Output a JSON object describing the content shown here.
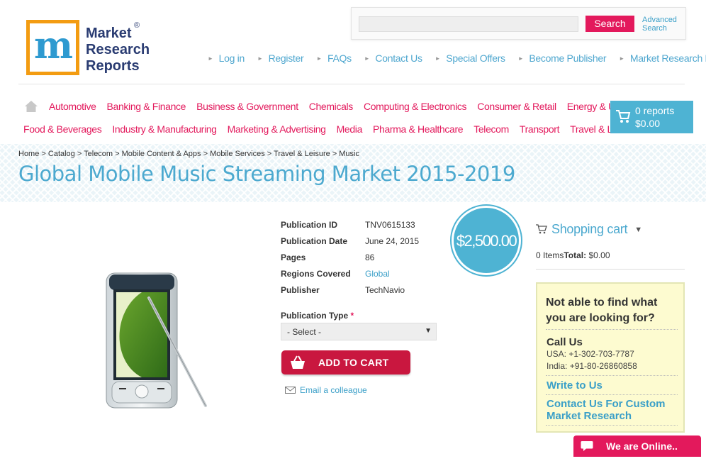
{
  "logo": {
    "text_line1": "Market",
    "text_line2": "Research",
    "text_line3": "Reports",
    "reg": "®",
    "mark": "m"
  },
  "search": {
    "button": "Search",
    "advanced": "Advanced Search",
    "value": ""
  },
  "top_links": [
    "Log in",
    "Register",
    "FAQs",
    "Contact Us",
    "Special Offers",
    "Become Publisher",
    "Market Research Blog"
  ],
  "nav_row1": [
    "Automotive",
    "Banking & Finance",
    "Business & Government",
    "Chemicals",
    "Computing & Electronics",
    "Consumer & Retail",
    "Energy & Utilities"
  ],
  "nav_row2": [
    "Food & Beverages",
    "Industry & Manufacturing",
    "Marketing & Advertising",
    "Media",
    "Pharma & Healthcare",
    "Telecom",
    "Transport",
    "Travel & Leisure"
  ],
  "cart_button": {
    "count": "0 reports",
    "total": "$0.00"
  },
  "breadcrumb": "Home > Catalog > Telecom > Mobile Content & Apps > Mobile Services > Travel & Leisure > Music",
  "page_title": "Global Mobile Music Streaming Market 2015-2019",
  "details": [
    {
      "label": "Publication ID",
      "value": "TNV0615133"
    },
    {
      "label": "Publication Date",
      "value": "June 24, 2015"
    },
    {
      "label": "Pages",
      "value": "86"
    },
    {
      "label": "Regions Covered",
      "value": "Global"
    },
    {
      "label": "Publisher",
      "value": "TechNavio"
    }
  ],
  "price": "$2,500.00",
  "publication_type": {
    "label": "Publication Type",
    "required_mark": "*",
    "selected": "- Select -"
  },
  "add_to_cart": "ADD TO CART",
  "email_colleague": "Email a colleague",
  "shopping_cart": {
    "title": "Shopping cart",
    "items": "0 Items",
    "total_label": "Total:",
    "total": "$0.00"
  },
  "help_box": {
    "question": "Not able to find what you are looking for?",
    "call_us": "Call Us",
    "usa": "USA: +1-302-703-7787",
    "india": "India: +91-80-26860858",
    "write": "Write to Us",
    "custom": "Contact Us For Custom Market Research"
  },
  "online_chat": "We are Online..",
  "colors": {
    "accent_pink": "#e3195c",
    "accent_blue": "#4eb3d3",
    "link_blue": "#3a9fc8",
    "cart_red": "#c9173f",
    "help_bg": "#fdfbd0"
  }
}
